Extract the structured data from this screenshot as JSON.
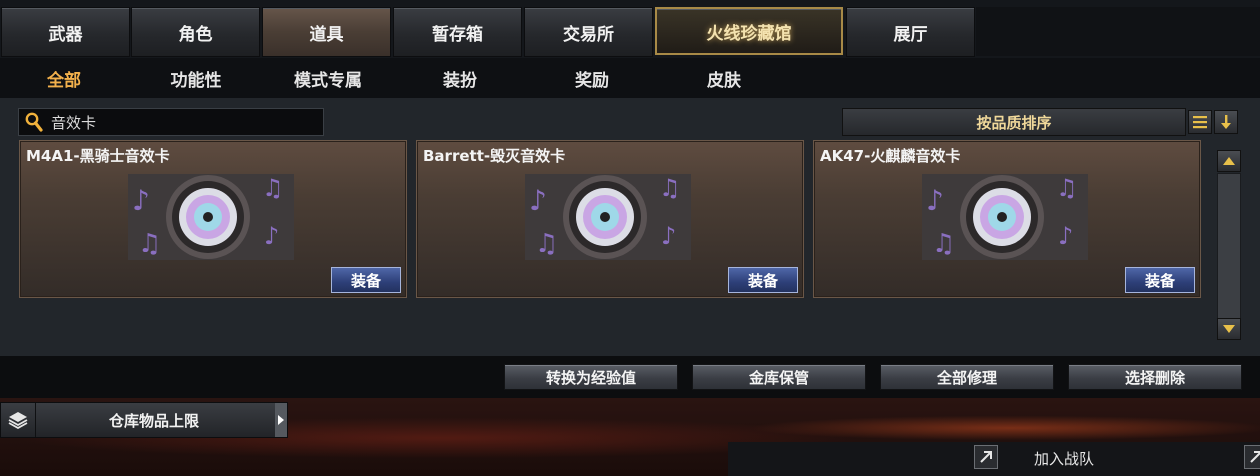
{
  "top_tabs": [
    {
      "label": "武器"
    },
    {
      "label": "角色"
    },
    {
      "label": "道具"
    },
    {
      "label": "暂存箱"
    },
    {
      "label": "交易所"
    },
    {
      "label": "火线珍藏馆"
    },
    {
      "label": "展厅"
    }
  ],
  "selected_top_tab": "道具",
  "sub_tabs": [
    {
      "label": "全部"
    },
    {
      "label": "功能性"
    },
    {
      "label": "模式专属"
    },
    {
      "label": "装扮"
    },
    {
      "label": "奖励"
    },
    {
      "label": "皮肤"
    }
  ],
  "selected_sub_tab": "全部",
  "search": {
    "value": "音效卡",
    "icon": "search-icon"
  },
  "sort": {
    "label": "按品质排序",
    "menu_icon": "list-icon",
    "order_icon": "sort-down-arrow-icon"
  },
  "items": [
    {
      "name": "M4A1-黑骑士音效卡",
      "button": "装备",
      "icon": "music-disc-icon"
    },
    {
      "name": "Barrett-毁灭音效卡",
      "button": "装备",
      "icon": "music-disc-icon"
    },
    {
      "name": "AK47-火麒麟音效卡",
      "button": "装备",
      "icon": "music-disc-icon"
    }
  ],
  "actions": [
    {
      "label": "转换为经验值"
    },
    {
      "label": "金库保管"
    },
    {
      "label": "全部修理"
    },
    {
      "label": "选择删除"
    }
  ],
  "storage_limit": {
    "label": "仓库物品上限",
    "icon": "layers-icon"
  },
  "team": {
    "label": "加入战队",
    "icon": "expand-icon"
  },
  "colors": {
    "accent": "#f3b14c",
    "equip_button": "#2d3f78",
    "special_tab_border": "#a88a47"
  }
}
